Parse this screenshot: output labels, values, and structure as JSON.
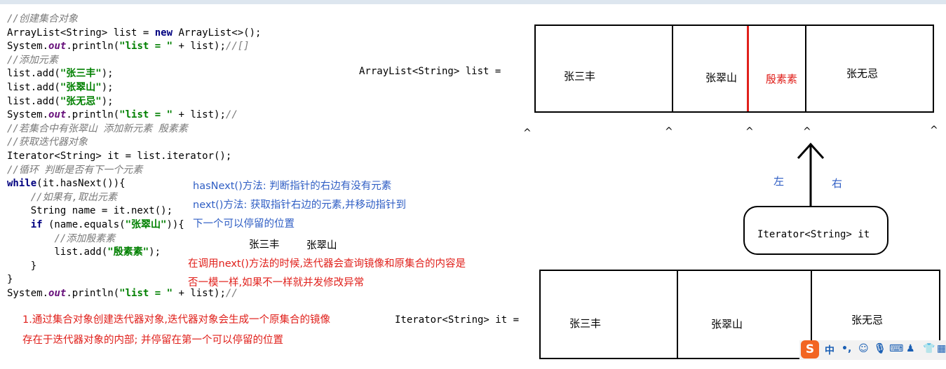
{
  "code": {
    "lines": [
      [
        {
          "t": "//创建集合对象",
          "c": "cm"
        }
      ],
      [
        {
          "t": "ArrayList<String> list = "
        },
        {
          "t": "new",
          "c": "kw"
        },
        {
          "t": " ArrayList<>();"
        }
      ],
      [
        {
          "t": "System."
        },
        {
          "t": "out",
          "c": "fld"
        },
        {
          "t": ".println("
        },
        {
          "t": "\"list = \"",
          "c": "str"
        },
        {
          "t": " + list);"
        },
        {
          "t": "//[]",
          "c": "cm"
        }
      ],
      [
        {
          "t": "//添加元素",
          "c": "cm"
        }
      ],
      [
        {
          "t": "list.add("
        },
        {
          "t": "\"张三丰\"",
          "c": "str"
        },
        {
          "t": ");"
        }
      ],
      [
        {
          "t": "list.add("
        },
        {
          "t": "\"张翠山\"",
          "c": "str"
        },
        {
          "t": ");"
        }
      ],
      [
        {
          "t": "list.add("
        },
        {
          "t": "\"张无忌\"",
          "c": "str"
        },
        {
          "t": ");"
        }
      ],
      [
        {
          "t": "System."
        },
        {
          "t": "out",
          "c": "fld"
        },
        {
          "t": ".println("
        },
        {
          "t": "\"list = \"",
          "c": "str"
        },
        {
          "t": " + list);"
        },
        {
          "t": "//",
          "c": "cm"
        }
      ],
      [
        {
          "t": "//若集合中有张翠山 添加新元素 殷素素",
          "c": "cm"
        }
      ],
      [
        {
          "t": "//获取迭代器对象",
          "c": "cm"
        }
      ],
      [
        {
          "t": "Iterator<String> it = list.iterator();"
        }
      ],
      [
        {
          "t": "//循环 判断是否有下一个元素",
          "c": "cm"
        }
      ],
      [
        {
          "t": "while",
          "c": "kw"
        },
        {
          "t": "(it.hasNext()){"
        }
      ],
      [
        {
          "t": "    "
        },
        {
          "t": "//如果有,取出元素",
          "c": "cm"
        }
      ],
      [
        {
          "t": "    String name = it.next();"
        }
      ],
      [
        {
          "t": "    "
        },
        {
          "t": "if",
          "c": "kw"
        },
        {
          "t": " (name.equals("
        },
        {
          "t": "\"张翠山\"",
          "c": "str"
        },
        {
          "t": ")){"
        }
      ],
      [
        {
          "t": "        "
        },
        {
          "t": "//添加殷素素",
          "c": "cm"
        }
      ],
      [
        {
          "t": "        list.add("
        },
        {
          "t": "\"殷素素\"",
          "c": "str"
        },
        {
          "t": ");"
        }
      ],
      [
        {
          "t": "    }"
        }
      ],
      [
        {
          "t": "}"
        }
      ],
      [
        {
          "t": "System."
        },
        {
          "t": "out",
          "c": "fld"
        },
        {
          "t": ".println("
        },
        {
          "t": "\"list = \"",
          "c": "str"
        },
        {
          "t": " + list);"
        },
        {
          "t": "//",
          "c": "cm"
        }
      ]
    ]
  },
  "diagram": {
    "list_label": "ArrayList<String> list =",
    "list_cells": [
      "张三丰",
      "张翠山",
      "殷素素",
      "张无忌"
    ],
    "carets": [
      "^",
      "^",
      "^",
      "^",
      "^"
    ],
    "left_label": "左",
    "right_label": "右",
    "iterator_box_label": "Iterator<String> it",
    "iterator_label": "Iterator<String> it =",
    "iterator_cells": [
      "张三丰",
      "张翠山",
      "张无忌"
    ]
  },
  "notes": {
    "has_next": "hasNext()方法: 判断指针的右边有没有元素",
    "next_line1": "next()方法: 获取指针右边的元素,并移动指针到",
    "next_line2": "下一个可以停留的位置",
    "taken1": "张三丰",
    "taken2": "张翠山",
    "mod_line1": "在调用next()方法的时候,迭代器会查询镜像和原集合的内容是",
    "mod_line2": "否一模一样,如果不一样就并发修改异常",
    "create_line1": "1.通过集合对象创建迭代器对象,迭代器对象会生成一个原集合的镜像",
    "create_line2": "存在于迭代器对象的内部;   并停留在第一个可以停留的位置"
  },
  "colors": {
    "blue_note": "#2f5ec4",
    "red_note": "#e0201b",
    "insert_line": "#e0201b"
  },
  "ime": {
    "logo": "S",
    "mode": "中",
    "punct": "•,"
  }
}
